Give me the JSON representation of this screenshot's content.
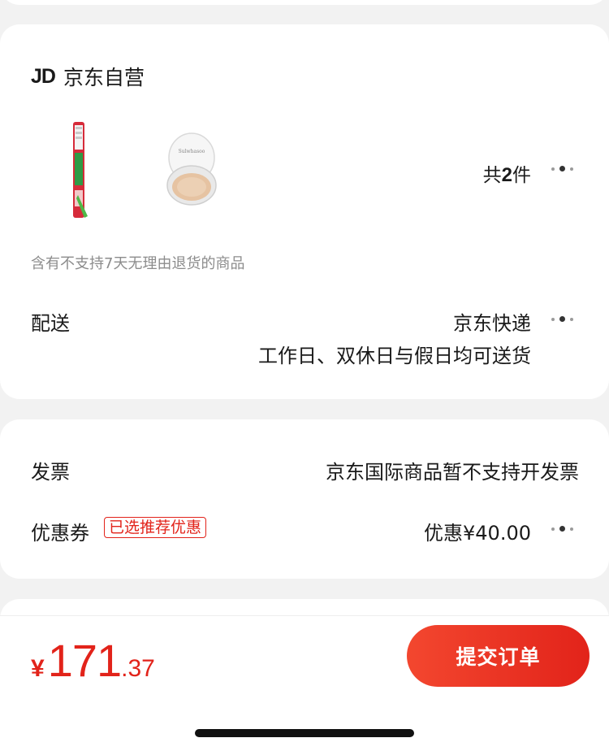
{
  "shop": {
    "logo": "JD",
    "name": "京东自营",
    "items": [
      {
        "icon": "toothbrush-product-image"
      },
      {
        "icon": "cushion-compact-product-image"
      }
    ],
    "count_prefix": "共",
    "count_value": "2",
    "count_suffix": "件",
    "return_note": "含有不支持7天无理由退货的商品"
  },
  "delivery": {
    "label": "配送",
    "carrier": "京东快递",
    "schedule": "工作日、双休日与假日均可送货"
  },
  "invoice": {
    "label": "发票",
    "value": "京东国际商品暂不支持开发票"
  },
  "coupon": {
    "label": "优惠券",
    "badge": "已选推荐优惠",
    "value": "优惠¥40.00"
  },
  "footer": {
    "currency": "¥",
    "price_int": "171",
    "price_dec": ".37",
    "submit_label": "提交订单"
  },
  "colors": {
    "accent": "#e2231a",
    "background": "#f2f2f2"
  }
}
